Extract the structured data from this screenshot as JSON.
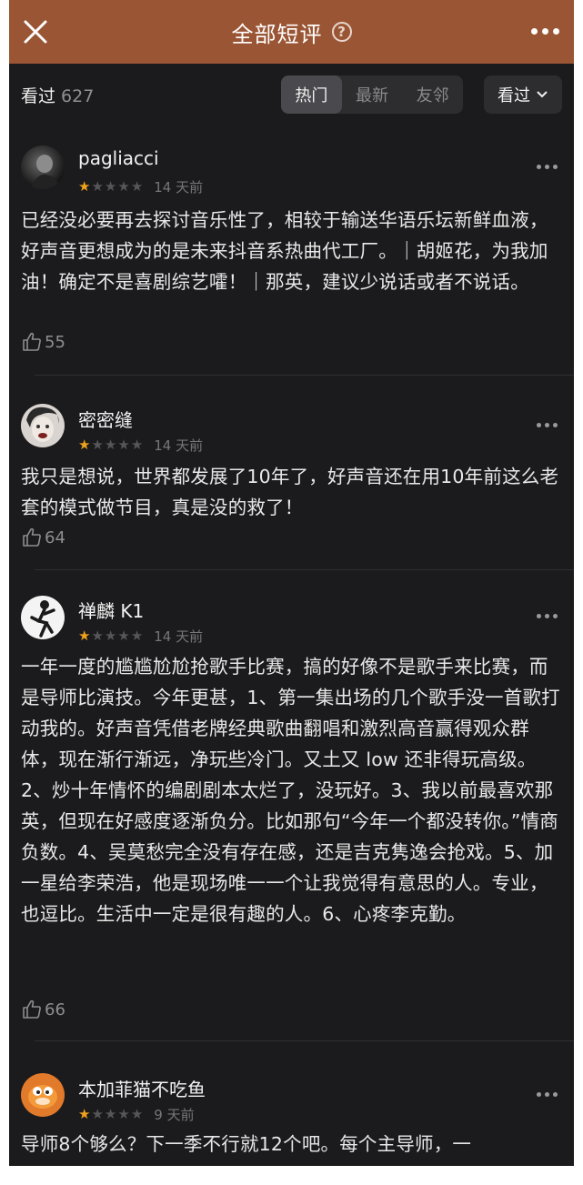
{
  "header": {
    "title": "全部短评",
    "help_glyph": "?"
  },
  "filter": {
    "seen_label": "看过",
    "seen_count": "627",
    "tabs": [
      "热门",
      "最新",
      "友邻"
    ],
    "active_tab": "热门",
    "dropdown_label": "看过"
  },
  "reviews": [
    {
      "user": "pagliacci",
      "rating": 1,
      "time": "14 天前",
      "text": "已经没必要再去探讨音乐性了，相较于输送华语乐坛新鲜血液，好声音更想成为的是未来抖音系热曲代工厂。｜胡姬花，为我加油！确定不是喜剧综艺嚯！｜那英，建议少说话或者不说话。",
      "likes": "55"
    },
    {
      "user": "密密缝",
      "rating": 1,
      "time": "14 天前",
      "text": "我只是想说，世界都发展了10年了，好声音还在用10年前这么老套的模式做节目，真是没的救了！",
      "likes": "64"
    },
    {
      "user": "禅麟 K1",
      "rating": 1,
      "time": "14 天前",
      "text": "一年一度的尴尴尬尬抢歌手比赛，搞的好像不是歌手来比赛，而是导师比演技。今年更甚，1、第一集出场的几个歌手没一首歌打动我的。好声音凭借老牌经典歌曲翻唱和激烈高音赢得观众群体，现在渐行渐远，净玩些冷门。又土又 low 还非得玩高级。2、炒十年情怀的编剧剧本太烂了，没玩好。3、我以前最喜欢那英，但现在好感度逐渐负分。比如那句“今年一个都没转你。”情商负数。4、吴莫愁完全没有存在感，还是吉克隽逸会抢戏。5、加一星给李荣浩，他是现场唯一一个让我觉得有意思的人。专业，也逗比。生活中一定是很有趣的人。6、心疼李克勤。",
      "likes": "66"
    },
    {
      "user": "本加菲猫不吃鱼",
      "rating": 1,
      "time": "9 天前",
      "text": "导师8个够么？下一季不行就12个吧。每个主导师，一",
      "likes": ""
    }
  ],
  "colors": {
    "header_bg": "#9a5634",
    "page_bg": "#1b1b1d",
    "star_on": "#f0a21c",
    "star_off": "#55555a"
  }
}
